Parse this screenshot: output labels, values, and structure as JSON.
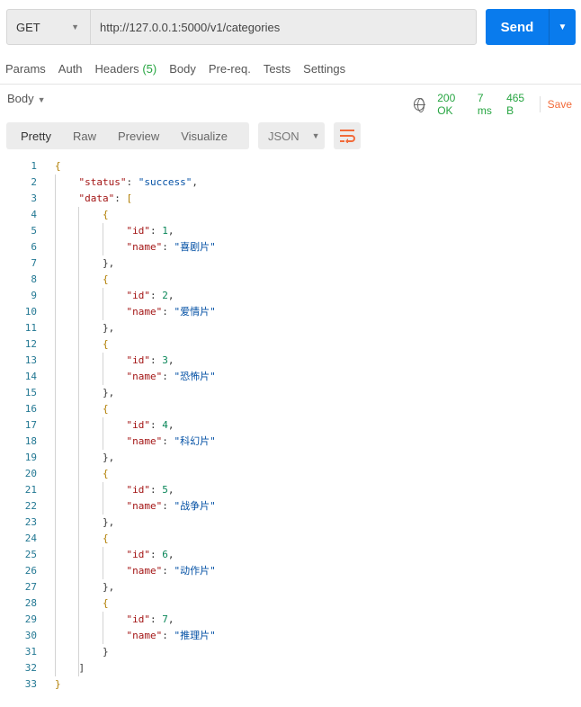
{
  "request": {
    "method": "GET",
    "url": "http://127.0.0.1:5000/v1/categories",
    "send_label": "Send"
  },
  "tabs": [
    {
      "label": "Params"
    },
    {
      "label": "Auth"
    },
    {
      "label": "Headers",
      "count": "(5)"
    },
    {
      "label": "Body"
    },
    {
      "label": "Pre-req."
    },
    {
      "label": "Tests"
    },
    {
      "label": "Settings"
    }
  ],
  "response": {
    "section_label": "Body",
    "status": "200 OK",
    "time": "7 ms",
    "size": "465 B",
    "save_label": "Save",
    "views": [
      "Pretty",
      "Raw",
      "Preview",
      "Visualize"
    ],
    "format": "JSON",
    "body": {
      "status": "success",
      "data": [
        {
          "id": 1,
          "name": "喜剧片"
        },
        {
          "id": 2,
          "name": "爱情片"
        },
        {
          "id": 3,
          "name": "恐怖片"
        },
        {
          "id": 4,
          "name": "科幻片"
        },
        {
          "id": 5,
          "name": "战争片"
        },
        {
          "id": 6,
          "name": "动作片"
        },
        {
          "id": 7,
          "name": "推理片"
        }
      ]
    }
  },
  "colors": {
    "accent": "#097bed",
    "success": "#26a541",
    "save": "#f26b3a",
    "key": "#a31515",
    "string": "#0451a5",
    "number": "#098658"
  }
}
